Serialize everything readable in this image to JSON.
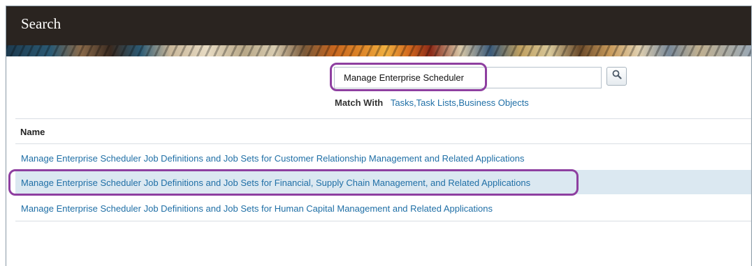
{
  "page": {
    "title": "Search"
  },
  "search": {
    "value": "Manage Enterprise Scheduler",
    "button_icon": "search-icon",
    "match_with_label": "Match With",
    "match_with_value": "Tasks,Task Lists,Business Objects"
  },
  "results": {
    "column_header": "Name",
    "rows": [
      {
        "label": "Manage Enterprise Scheduler Job Definitions and Job Sets for Customer Relationship Management and Related Applications",
        "selected": false
      },
      {
        "label": "Manage Enterprise Scheduler Job Definitions and Job Sets for Financial, Supply Chain Management, and Related Applications",
        "selected": true
      },
      {
        "label": "Manage Enterprise Scheduler Job Definitions and Job Sets for Human Capital Management and Related Applications",
        "selected": false
      }
    ]
  },
  "colors": {
    "title_bar": "#2a2420",
    "link": "#1f6fa6",
    "selected_row": "#dbe8f1",
    "highlight_annotation": "#8e3fa0"
  }
}
